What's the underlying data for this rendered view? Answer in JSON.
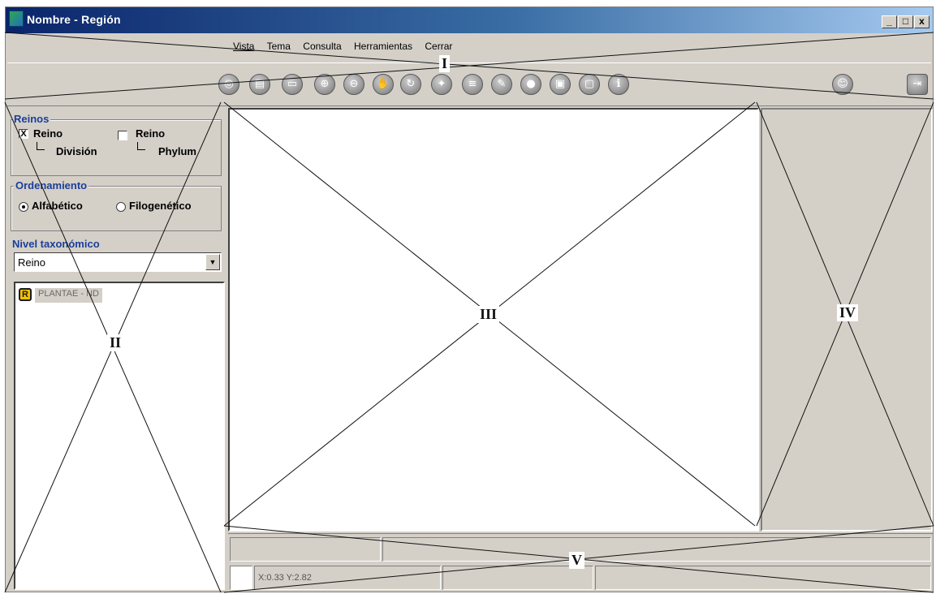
{
  "window": {
    "title": "Nombre - Región",
    "controls": {
      "minimize": "_",
      "maximize": "□",
      "close": "x"
    }
  },
  "menu": [
    "Vista",
    "Tema",
    "Consulta",
    "Herramientas",
    "Cerrar"
  ],
  "toolbar": {
    "icons": [
      "globe-icon",
      "print-icon",
      "print-preview-icon",
      "zoom-in-icon",
      "zoom-out-icon",
      "pan-hand-icon",
      "refresh-icon",
      "identify-icon",
      "layers-icon",
      "tools-icon",
      "select-icon",
      "image-icon",
      "info-icon"
    ],
    "right_icons": [
      "face-icon",
      "exit-icon"
    ]
  },
  "reinos": {
    "title": "Reinos",
    "option1": {
      "label": "Reino",
      "sub": "División",
      "checked": true,
      "mark": "X"
    },
    "option2": {
      "label": "Reino",
      "sub": "Phylum",
      "checked": false
    }
  },
  "ordenamiento": {
    "title": "Ordenamiento",
    "options": [
      "Alfabético",
      "Filogenético"
    ],
    "selected": "Alfabético"
  },
  "nivel": {
    "label": "Nivel taxonómico",
    "value": "Reino"
  },
  "tree": {
    "node_icon_letter": "R",
    "node_label": "PLANTAE - ND"
  },
  "status": {
    "coords": "X:0.33 Y:2.82"
  },
  "annotations": {
    "I": "I",
    "II": "II",
    "III": "III",
    "IV": "IV",
    "V": "V"
  }
}
